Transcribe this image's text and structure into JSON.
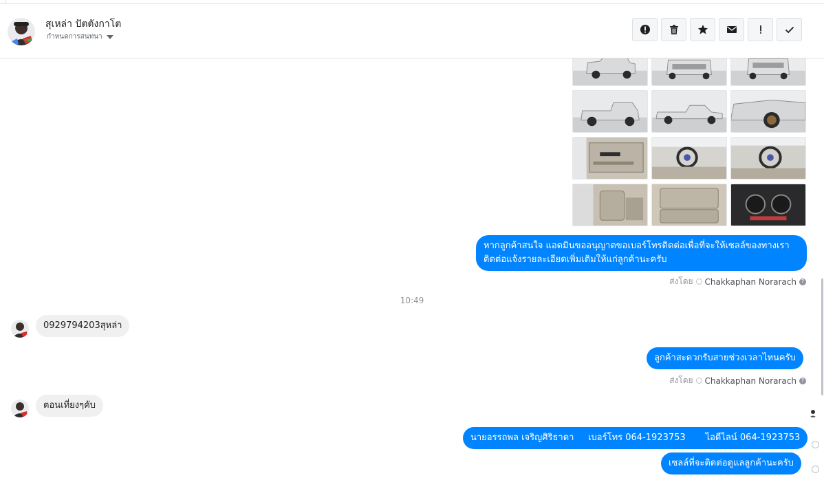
{
  "header": {
    "contact_name": "สุเหล่า ปัตตังกาโต",
    "subtitle": "กำหนดการสนทนา",
    "actions": [
      {
        "name": "mark-spam-button",
        "icon": "alert-circle-icon"
      },
      {
        "name": "delete-button",
        "icon": "trash-icon"
      },
      {
        "name": "star-button",
        "icon": "star-icon"
      },
      {
        "name": "mark-unread-button",
        "icon": "envelope-icon"
      },
      {
        "name": "follow-up-button",
        "icon": "exclamation-icon"
      },
      {
        "name": "mark-done-button",
        "icon": "checkmark-icon"
      }
    ]
  },
  "thread": {
    "photos": [
      "truck-front-view",
      "truck-rear-view",
      "truck-rear-view-2",
      "truck-side-rear",
      "truck-side-profile",
      "truck-front-wheel",
      "truck-door-interior",
      "truck-steering-wheel",
      "truck-dashboard",
      "truck-seats",
      "truck-rear-seat",
      "truck-instrument-cluster"
    ],
    "messages": [
      {
        "from": "page",
        "text": "หากลูกค้าสนใจ แอดมินขออนุญาตขอเบอร์โทรติดต่อเพื่อที่จะให้เซลล์ของทางเรา ติดต่อแจ้งรายละเอียดเพิ่มเติมให้แก่ลูกค้านะครับ"
      },
      {
        "from": "customer",
        "text": "0929794203สุหล่า"
      },
      {
        "from": "page",
        "text": "ลูกค้าสะดวกรับสายช่วงเวลาไหนครับ"
      },
      {
        "from": "customer",
        "text": "ตอนเที่ยงๆคับ"
      },
      {
        "from": "page",
        "text": "นายอรรถพล เจริญศิริธาดา     เบอร์โทร 064-1923753       ไอดีไลน์ 064-1923753"
      },
      {
        "from": "page",
        "text": "เซลล์ที่จะติดต่อดูแลลูกค้านะครับ"
      }
    ],
    "sent_by_label": "ส่งโดย",
    "sent_by_name": "Chakkaphan Norarach",
    "help_glyph": "?",
    "timestamp": "10:49"
  },
  "colors": {
    "outgoing_bubble": "#0084ff",
    "incoming_bubble": "#f1f0f0",
    "meta_text": "#90949c"
  }
}
